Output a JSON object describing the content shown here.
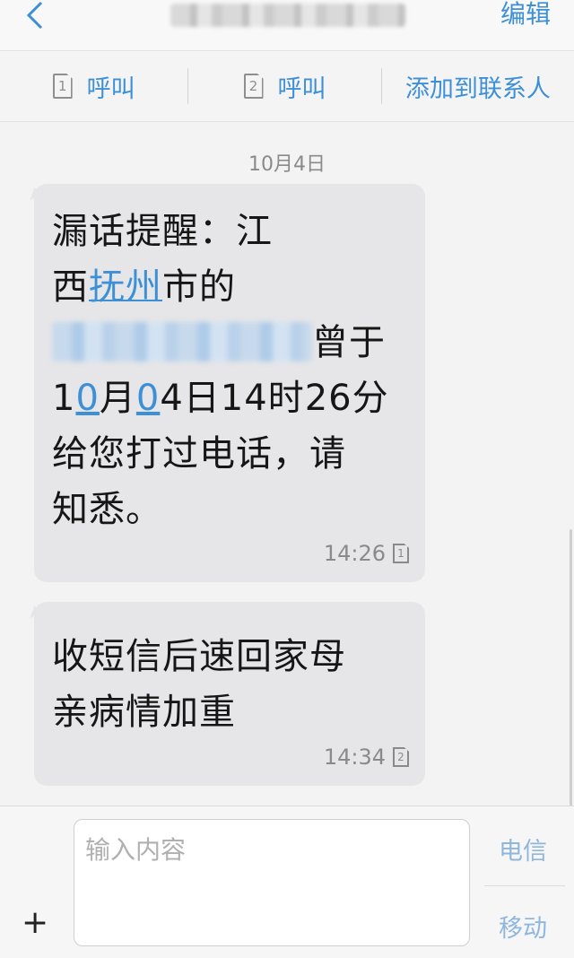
{
  "header": {
    "edit_label": "编辑"
  },
  "actions": {
    "call1_label": "呼叫",
    "call1_sim": "1",
    "call2_label": "呼叫",
    "call2_sim": "2",
    "add_contact_label": "添加到联系人"
  },
  "thread": {
    "date": "10月4日",
    "messages": [
      {
        "line1": "漏话提醒：江",
        "line2_pre": "西",
        "line2_link": "抚州",
        "line2_post": "市的",
        "line3_post": "曾于",
        "line4_a": "1",
        "line4_b": "0",
        "line4_c": "月",
        "line4_d": "0",
        "line4_e": "4日14时26分",
        "line5": "给您打过电话，请",
        "line6": "知悉。",
        "time": "14:26",
        "sim": "1"
      },
      {
        "line1": "收短信后速回家母",
        "line2": "亲病情加重",
        "time": "14:34",
        "sim": "2"
      }
    ]
  },
  "composer": {
    "placeholder": "输入内容",
    "send_telecom": "电信",
    "send_mobile": "移动",
    "plus": "+"
  }
}
